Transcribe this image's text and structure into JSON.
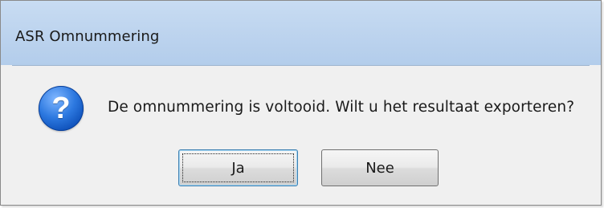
{
  "window": {
    "title": "ASR Omnummering"
  },
  "dialog": {
    "icon": "question-icon",
    "icon_glyph": "?",
    "message": "De omnummering is voltooid. Wilt u het resultaat exporteren?",
    "buttons": {
      "yes_label": "Ja",
      "no_label": "Nee"
    }
  },
  "colors": {
    "title_bar": "#bcd3ee",
    "content_bg": "#f0f0f0",
    "icon_blue": "#2d79e0",
    "default_button_border": "#3c7fb1"
  }
}
